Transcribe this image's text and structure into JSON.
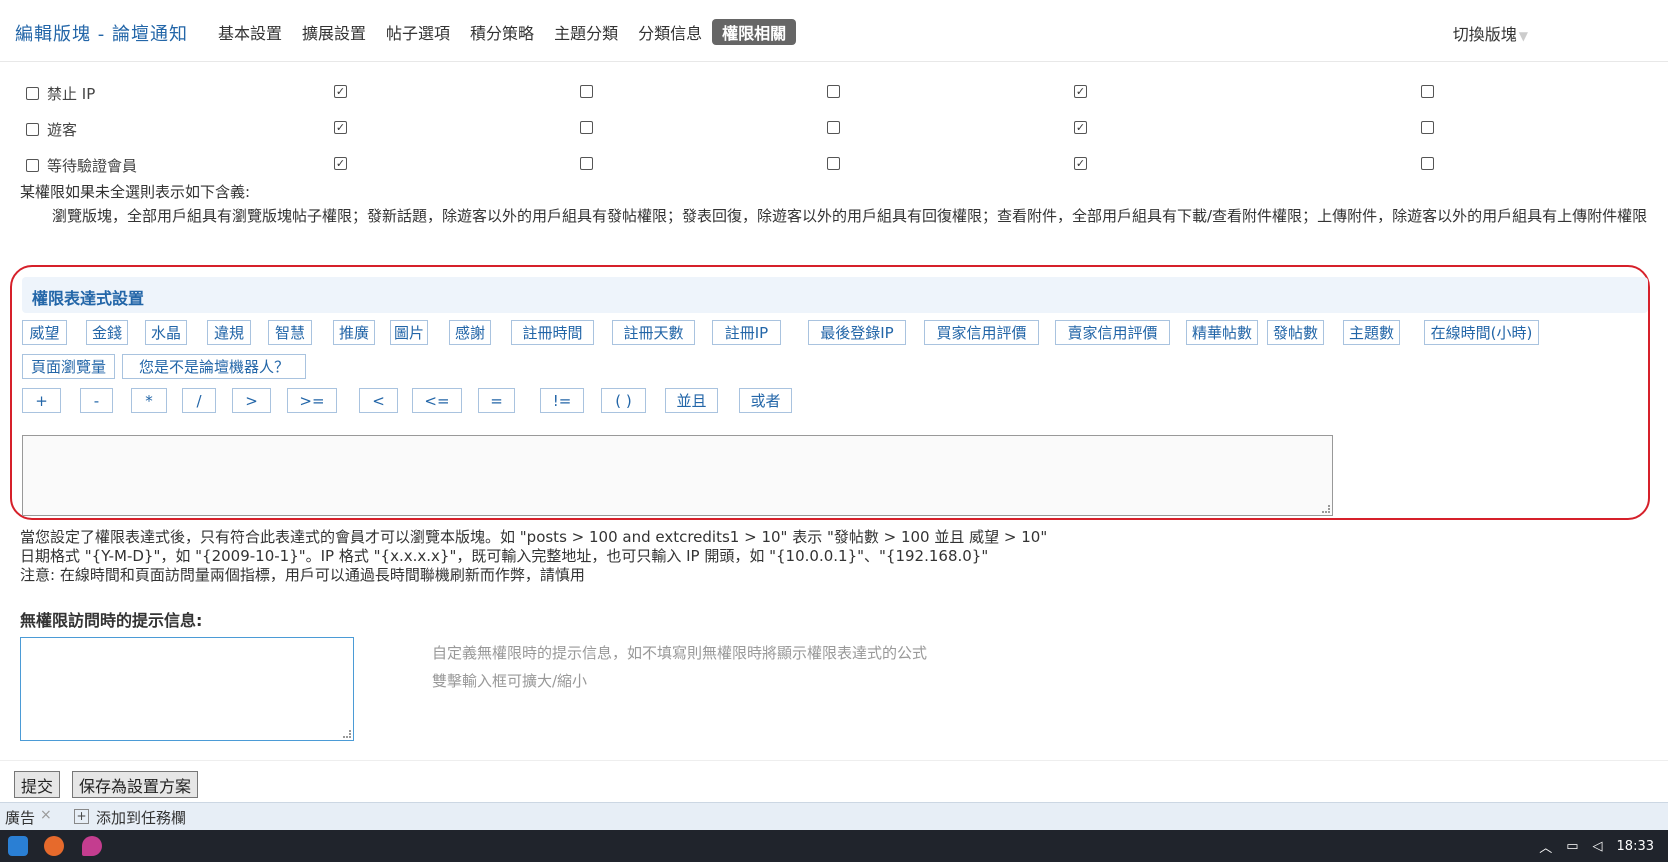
{
  "header": {
    "title": "編輯版塊 - 論壇通知",
    "tabs": [
      "基本設置",
      "擴展設置",
      "帖子選項",
      "積分策略",
      "主題分類",
      "分類信息",
      "權限相關"
    ],
    "active_tab": 6,
    "switch_label": "切換版塊",
    "switch_caret": "▼"
  },
  "permission_rows": [
    {
      "label": "禁止 IP",
      "cols": [
        true,
        false,
        false,
        true,
        false
      ]
    },
    {
      "label": "遊客",
      "cols": [
        true,
        false,
        false,
        true,
        false
      ]
    },
    {
      "label": "等待驗證會員",
      "cols": [
        true,
        false,
        false,
        true,
        false
      ]
    }
  ],
  "notes": {
    "line1": "某權限如果未全選則表示如下含義:",
    "line2": "瀏覽版塊，全部用戶組具有瀏覽版塊帖子權限；發新話題，除遊客以外的用戶組具有發帖權限；發表回復，除遊客以外的用戶組具有回復權限；查看附件，全部用戶組具有下載/查看附件權限；上傳附件，除遊客以外的用戶組具有上傳附件權限"
  },
  "expression": {
    "title": "權限表達式設置",
    "row1": [
      "威望",
      "金錢",
      "水晶",
      "違規",
      "智慧",
      "推廣",
      "圖片",
      "感謝",
      "註冊時間",
      "註冊天數",
      "註冊IP",
      "最後登錄IP",
      "買家信用評價",
      "賣家信用評價",
      "精華帖數",
      "發帖數",
      "主題數",
      "在線時間(小時)"
    ],
    "row2": [
      "頁面瀏覽量",
      "您是不是論壇機器人？"
    ],
    "row3": [
      "+",
      "-",
      "*",
      "/",
      ">",
      ">=",
      "<",
      "<=",
      "=",
      "!=",
      "( )",
      "並且",
      "或者"
    ]
  },
  "help": {
    "line1": "當您設定了權限表達式後，只有符合此表達式的會員才可以瀏覽本版塊。如 \"posts > 100 and extcredits1 > 10\" 表示 \"發帖數 > 100 並且 威望 > 10\"",
    "line2": "日期格式 \"{Y-M-D}\"，如 \"{2009-10-1}\"。IP 格式 \"{x.x.x.x}\"，既可輸入完整地址，也可只輸入 IP 開頭，如 \"{10.0.0.1}\"、\"{192.168.0}\"",
    "line3": "注意: 在線時間和頁面訪問量兩個指標，用戶可以通過長時間聯機刷新而作弊，請慎用"
  },
  "no_permission": {
    "label": "無權限訪問時的提示信息:",
    "hint1": "自定義無權限時的提示信息，如不填寫則無權限時將顯示權限表達式的公式",
    "hint2": "雙擊輸入框可擴大/縮小"
  },
  "buttons": {
    "submit": "提交",
    "save_scheme": "保存為設置方案"
  },
  "adbar": {
    "ad": "廣告",
    "close": "×",
    "plus": "+",
    "add_task": "添加到任務欄"
  },
  "taskbar": {
    "time": "18:33"
  }
}
